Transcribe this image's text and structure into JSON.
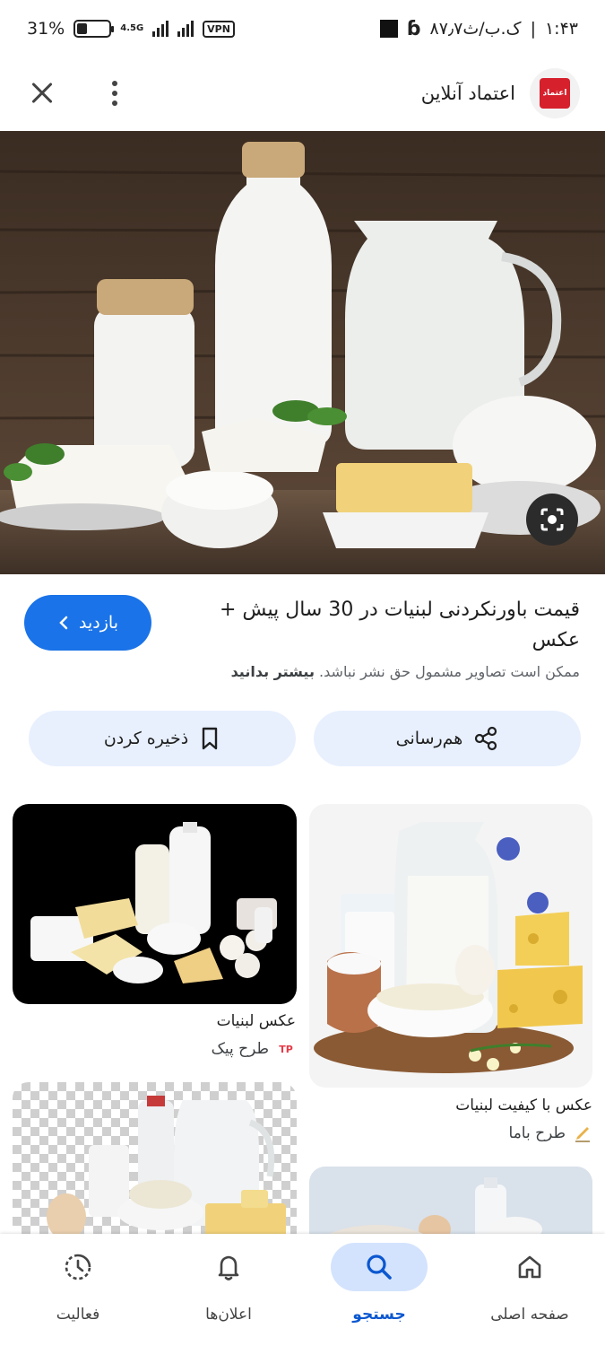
{
  "status_bar": {
    "time": "۱:۴۳",
    "speed": "۸۷٫۷ک.ب/ث",
    "network": "4.5G",
    "vpn": "VPN",
    "battery_percent": "31%",
    "battery_level": 0.31
  },
  "top_bar": {
    "site_name": "اعتماد آنلاین",
    "logo_text": "اعتماد"
  },
  "result": {
    "title": "قیمت باورنکردنی لبنیات در 30 سال پیش + عکس",
    "visit_label": "بازدید",
    "copyright_text": "ممکن است تصاویر مشمول حق نشر نباشد.",
    "learn_more": "بیشتر بدانید"
  },
  "actions": {
    "share_label": "هم‌رسانی",
    "save_label": "ذخیره کردن"
  },
  "related": [
    {
      "title": "عکس لبنیات",
      "source": "طرح پیک",
      "source_icon": "TP"
    },
    {
      "title": "عکس با کیفیت لبنیات",
      "source": "طرح باما",
      "source_icon": "pen"
    }
  ],
  "bottom_nav": [
    {
      "label": "صفحه اصلی",
      "icon": "home-icon"
    },
    {
      "label": "جستجو",
      "icon": "search-icon",
      "active": true
    },
    {
      "label": "اعلان‌ها",
      "icon": "bell-icon"
    },
    {
      "label": "فعالیت",
      "icon": "activity-icon"
    }
  ]
}
